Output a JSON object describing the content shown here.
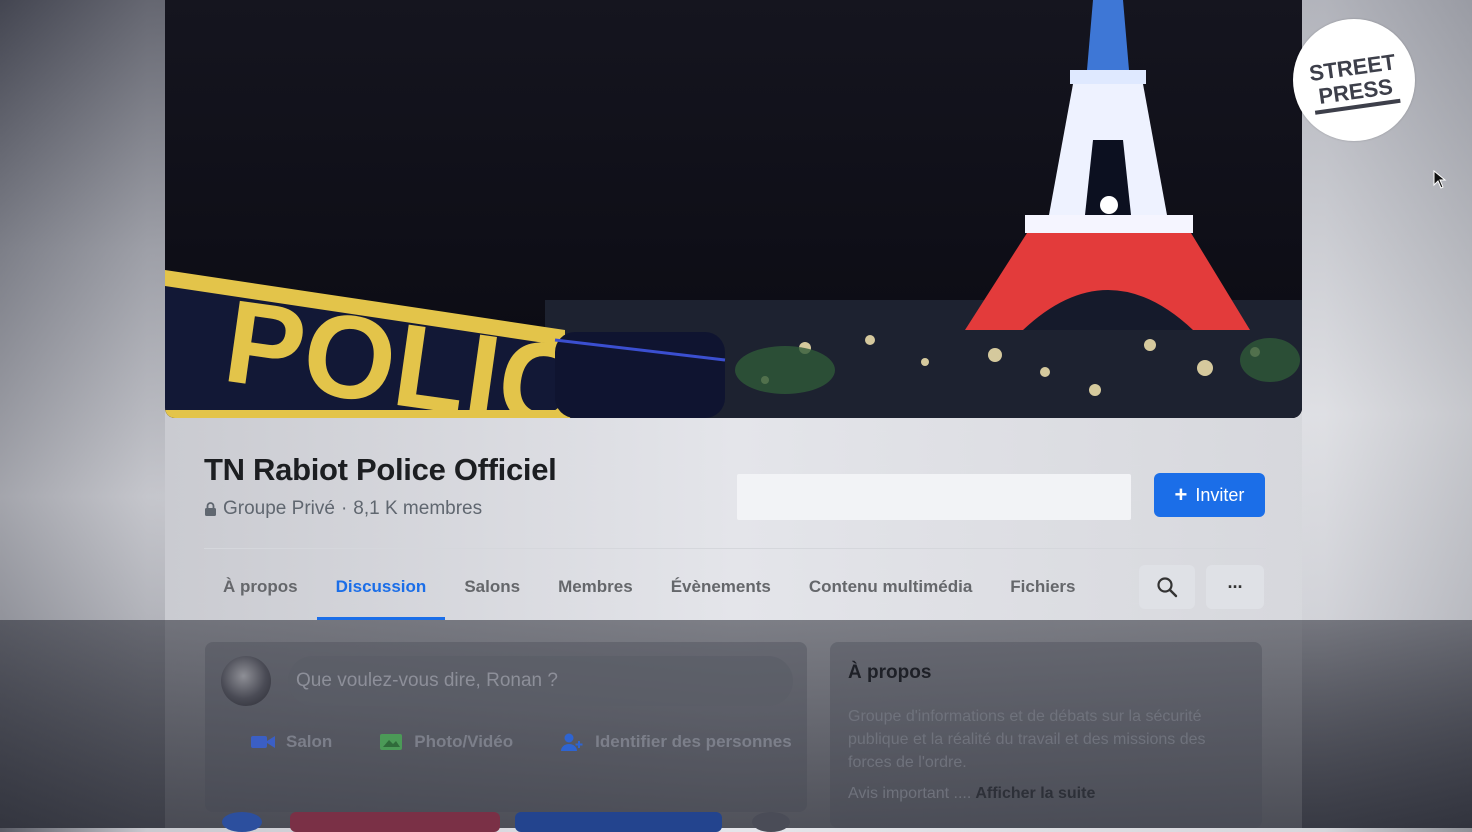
{
  "logo_text": "STREET PRESS",
  "cover": {
    "tape_text": "POLICE"
  },
  "group": {
    "title": "TN Rabiot Police Officiel",
    "privacy": "Groupe Privé",
    "separator": " · ",
    "members": "8,1 K membres",
    "invite_label": "Inviter"
  },
  "tabs": [
    {
      "label": "À propos",
      "active": false
    },
    {
      "label": "Discussion",
      "active": true
    },
    {
      "label": "Salons",
      "active": false
    },
    {
      "label": "Membres",
      "active": false
    },
    {
      "label": "Évènements",
      "active": false
    },
    {
      "label": "Contenu multimédia",
      "active": false
    },
    {
      "label": "Fichiers",
      "active": false
    }
  ],
  "tab_tools": {
    "search_icon": "search-icon",
    "more_label": "···"
  },
  "composer": {
    "placeholder": "Que voulez-vous dire, Ronan ?",
    "actions": [
      {
        "label": "Salon",
        "icon": "video-camera-icon",
        "color": "#3b5fc4"
      },
      {
        "label": "Photo/Vidéo",
        "icon": "photo-icon",
        "color": "#4b9a57"
      },
      {
        "label": "Identifier des personnes",
        "icon": "tag-people-icon",
        "color": "#2e64d1"
      }
    ]
  },
  "about": {
    "title": "À propos",
    "description": "Groupe d'informations et de débats sur la sécurité publique et la réalité du travail et des missions des forces de l'ordre.",
    "notice_prefix": "Avis important ....",
    "show_more": "Afficher la suite"
  },
  "colors": {
    "accent": "#1b6ee8",
    "title": "#1c1e21",
    "muted": "#65676b"
  }
}
